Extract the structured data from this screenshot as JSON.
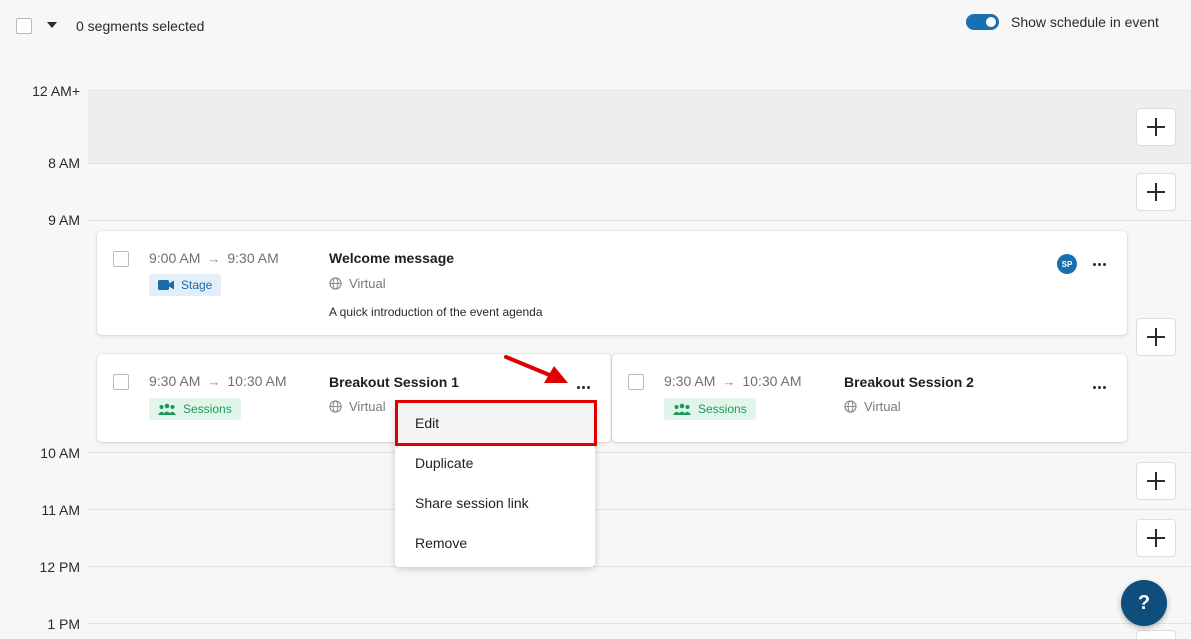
{
  "toolbar": {
    "selection_label": "0 segments selected",
    "toggle_label": "Show schedule in event",
    "toggle_on": true
  },
  "timeline": {
    "time_labels": [
      "12 AM+",
      "8 AM",
      "9 AM",
      "10 AM",
      "11 AM",
      "12 PM",
      "1 PM"
    ]
  },
  "sessions": [
    {
      "start": "9:00 AM",
      "end": "9:30 AM",
      "title": "Welcome message",
      "location": "Virtual",
      "description": "A quick introduction of the event agenda",
      "tag": "Stage",
      "tag_icon": "video-camera-icon",
      "avatar_initials": "SP"
    },
    {
      "start": "9:30 AM",
      "end": "10:30 AM",
      "title": "Breakout Session 1",
      "location": "Virtual",
      "tag": "Sessions",
      "tag_icon": "group-icon"
    },
    {
      "start": "9:30 AM",
      "end": "10:30 AM",
      "title": "Breakout Session 2",
      "location": "Virtual",
      "tag": "Sessions",
      "tag_icon": "group-icon"
    }
  ],
  "context_menu": {
    "items": [
      "Edit",
      "Duplicate",
      "Share session link",
      "Remove"
    ],
    "highlighted": "Edit"
  },
  "help": {
    "label": "?"
  },
  "colors": {
    "accent": "#1a6fb0",
    "stage_tag_bg": "#e4eef8",
    "sessions_tag_bg": "#e2f5ea",
    "sessions_green": "#1c9a55",
    "annotation_red": "#e00000",
    "help_button": "#0f4d7d"
  }
}
